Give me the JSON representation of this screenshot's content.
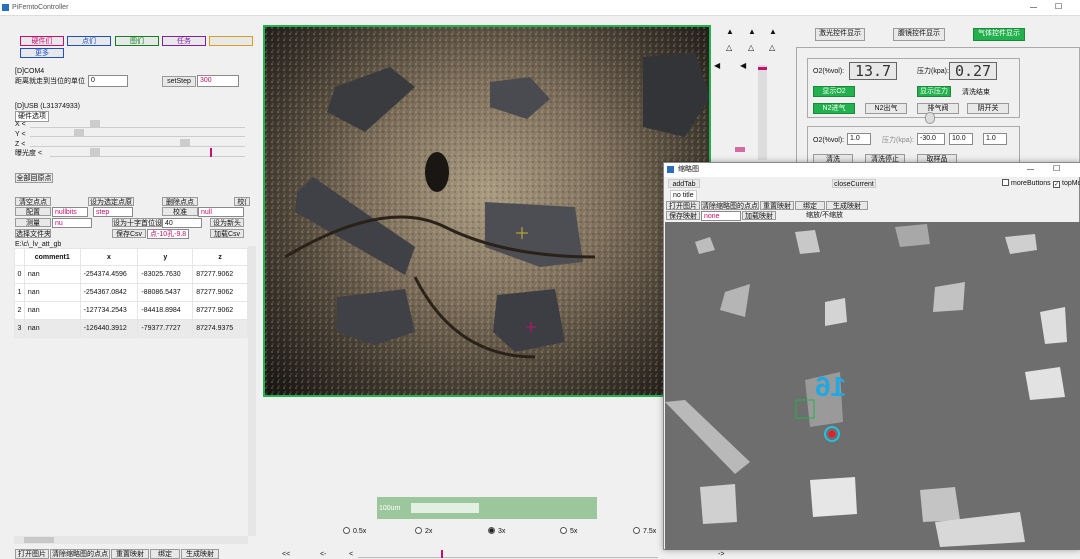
{
  "window": {
    "title": "PiFemtoController",
    "minimize": "—",
    "maximize": "☐"
  },
  "top_buttons": [
    "硬件们",
    "点们",
    "图们",
    "任务",
    "",
    "更多"
  ],
  "sections": {
    "com": "[D]COM4",
    "usb": "[D]USB  (L31374933)",
    "wh_label": "硬件选项"
  },
  "move": {
    "label": "距离就走到当位的单位",
    "value": "0",
    "setstep_label": "setStep",
    "step_value": "300"
  },
  "axes": [
    {
      "label": "X  <"
    },
    {
      "label": "Y  <"
    },
    {
      "label": "Z  <"
    },
    {
      "label": "曝光度  <"
    }
  ],
  "all_back": "全部回原点",
  "ctl": {
    "clear_points": "清空点点",
    "set_select_zero": "设为选定点原",
    "del_point": "删除点点",
    "calib_arrow": "校(",
    "config": "配置",
    "nobus": "nullbits",
    "step2": "step",
    "verify": "校准",
    "null2": "null",
    "measure": "测量",
    "null3": "nu",
    "set_cross": "设为十字首位设",
    "cross_val": "40",
    "set_home": "设为新头",
    "select_folder": "选择文件夹",
    "save_csv": "保存Csv",
    "csv_name": "点-10孔-9.8",
    "load_csv": "加载Csv"
  },
  "path": "E:\\c\\_lv_att_gb",
  "table": {
    "headers": [
      "comment1",
      "x",
      "y",
      "z"
    ],
    "rows": [
      {
        "i": "0",
        "c": "nan",
        "x": "-254374.4596",
        "y": "-83025.7630",
        "z": "87277.9062"
      },
      {
        "i": "1",
        "c": "nan",
        "x": "-254367.0842",
        "y": "-88086.5437",
        "z": "87277.9062"
      },
      {
        "i": "2",
        "c": "nan",
        "x": "-127734.2543",
        "y": "-84418.8984",
        "z": "87277.9062"
      },
      {
        "i": "3",
        "c": "nan",
        "x": "-126440.3912",
        "y": "-79377.7727",
        "z": "87274.9375"
      }
    ]
  },
  "bottom_left_buttons": [
    "打开图片",
    "清除缩略图的点点",
    "重置映射",
    "绑定",
    "生成映射"
  ],
  "camera": {
    "scale_label": "100um",
    "zoom": [
      {
        "label": "0.5x",
        "on": false
      },
      {
        "label": "2x",
        "on": false
      },
      {
        "label": "3x",
        "on": true
      },
      {
        "label": "5x",
        "on": false
      },
      {
        "label": "7.5x",
        "on": false
      }
    ]
  },
  "nav": {
    "fast_back": "<<",
    "back": "<-",
    "step_back": "<",
    "fwd": "->"
  },
  "right_tabs": {
    "laser": "激光控件显示",
    "maxlimit": "腹镜控件显示",
    "gas": "气体控件显示"
  },
  "gas": {
    "o2_label": "O2(%vol):",
    "o2_value": "13.7",
    "p_label": "压力(kpa):",
    "p_value": "0.27",
    "show_o2": "显示O2",
    "show_p": "显示压力",
    "wash_done": "清洗结束",
    "n2_in": "N2进气",
    "n2_out": "N2出气",
    "vent": "排气阀",
    "main_switch": "阴开关",
    "o2_set_label": "O2(%vol):",
    "o2_set": "1.0",
    "p_set_label": "压力(kpa):",
    "p_set": "-30.0",
    "v1": "10.0",
    "v2": "1.0",
    "b1": "清洗",
    "b2": "清洗停止",
    "b3": "取样品"
  },
  "thumb": {
    "title": "缩略图",
    "add_tab": "addTab",
    "close_current": "closeCurrent",
    "no_title": "no title",
    "more_buttons": "moreButtons",
    "topmost": "topMost",
    "row1": [
      "打开图片",
      "清除缩略图的点点",
      "重置映射",
      "绑定",
      "生成映射"
    ],
    "save_map": "保存映射",
    "none": "none",
    "load_map": "加载映射",
    "scale": "缩放/不缩放",
    "overlay_number": "16"
  },
  "colors": {
    "green": "#22b14c",
    "accent": "#c41070"
  }
}
